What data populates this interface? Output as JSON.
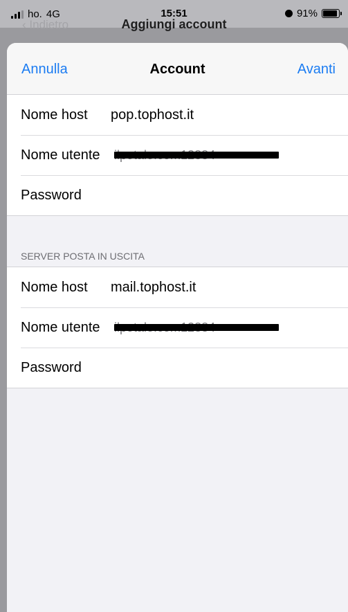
{
  "status_bar": {
    "carrier": "ho.",
    "network": "4G",
    "time": "15:51",
    "battery": "91%"
  },
  "background_nav": {
    "back_label": "Indietro",
    "title": "Aggiungi account"
  },
  "navbar": {
    "cancel_label": "Annulla",
    "title": "Account",
    "next_label": "Avanti"
  },
  "incoming": {
    "hostname_label": "Nome host",
    "hostname_value": "pop.tophost.it",
    "username_label": "Nome utente",
    "username_value": "ilpotale.com12884",
    "password_label": "Password"
  },
  "outgoing": {
    "section_title": "SERVER POSTA IN USCITA",
    "hostname_label": "Nome host",
    "hostname_value": "mail.tophost.it",
    "username_label": "Nome utente",
    "username_value": "ilpotale.com12884",
    "password_label": "Password"
  },
  "colors": {
    "accent": "#1b7cf2",
    "sheet_background": "#f2f2f6"
  }
}
